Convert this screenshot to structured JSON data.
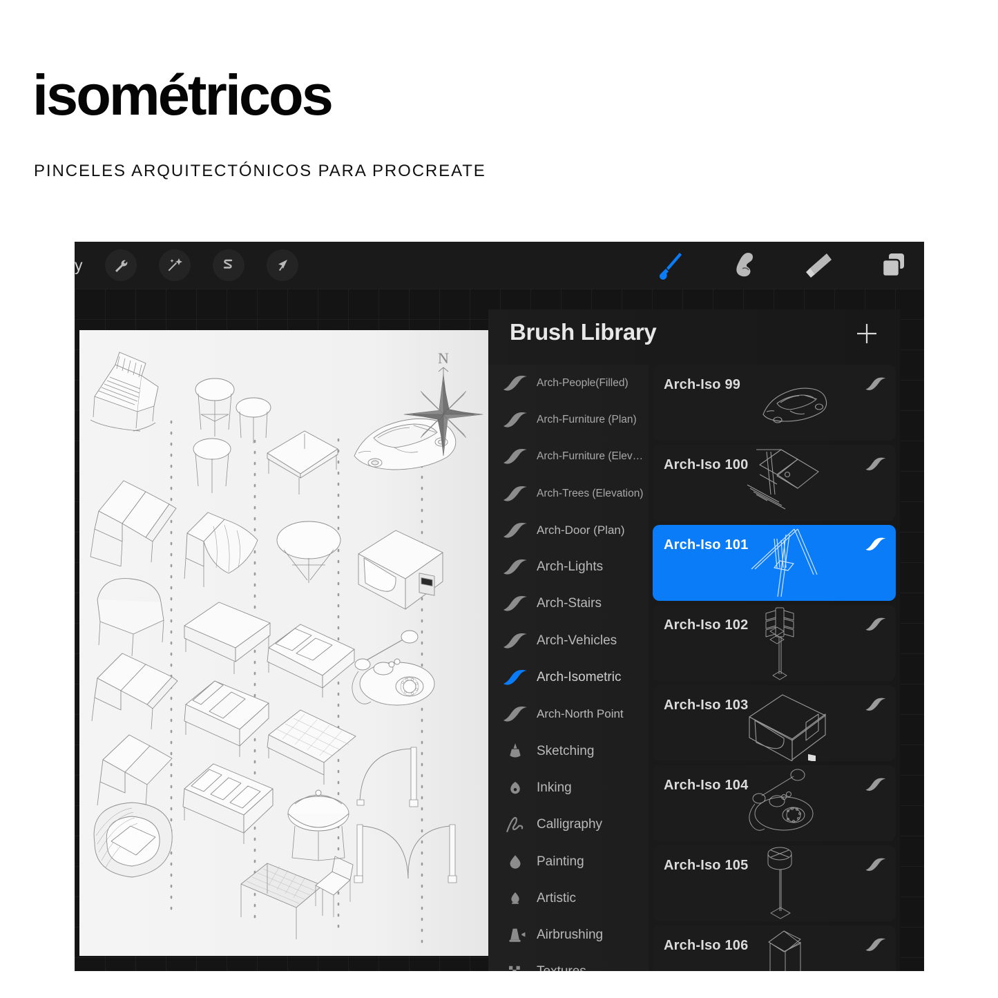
{
  "poster": {
    "title": "isométricos",
    "subtitle": "PINCELES ARQUITECTÓNICOS PARA PROCREATE"
  },
  "colors": {
    "accent_blue": "#0a7cf7",
    "panel_bg": "#1c1c1c",
    "toolbar_bg": "#1a1a1a",
    "canvas_bg": "#f2f2f2",
    "text_primary": "#e8e8e8",
    "text_secondary": "#b9b9b9"
  },
  "app": {
    "toolbar": {
      "gallery_label": "y",
      "left_tools": [
        {
          "name": "wrench-icon",
          "label": "Actions"
        },
        {
          "name": "magic-wand-icon",
          "label": "Adjustments"
        },
        {
          "name": "selection-icon",
          "label": "Selection"
        },
        {
          "name": "transform-arrow-icon",
          "label": "Transform"
        }
      ],
      "right_tools": [
        {
          "name": "paintbrush-icon",
          "label": "Paint",
          "active": true
        },
        {
          "name": "smudge-icon",
          "label": "Smudge",
          "active": false
        },
        {
          "name": "eraser-icon",
          "label": "Erase",
          "active": false
        },
        {
          "name": "layers-icon",
          "label": "Layers",
          "active": false
        }
      ]
    },
    "brush_library": {
      "title": "Brush Library",
      "add_label": "+",
      "sets": [
        {
          "label": "Arch-People(Filled)",
          "size": "small",
          "icon": "brush-stroke-icon",
          "active": false
        },
        {
          "label": "Arch-Furniture (Plan)",
          "size": "small",
          "icon": "brush-stroke-icon",
          "active": false
        },
        {
          "label": "Arch-Furniture (Elev…",
          "size": "small",
          "icon": "brush-stroke-icon",
          "active": false
        },
        {
          "label": "Arch-Trees (Elevation)",
          "size": "small",
          "icon": "brush-stroke-icon",
          "active": false
        },
        {
          "label": "Arch-Door (Plan)",
          "size": "mid",
          "icon": "brush-stroke-icon",
          "active": false
        },
        {
          "label": "Arch-Lights",
          "size": "",
          "icon": "brush-stroke-icon",
          "active": false
        },
        {
          "label": "Arch-Stairs",
          "size": "",
          "icon": "brush-stroke-icon",
          "active": false
        },
        {
          "label": "Arch-Vehicles",
          "size": "",
          "icon": "brush-stroke-icon",
          "active": false
        },
        {
          "label": "Arch-Isometric",
          "size": "",
          "icon": "brush-stroke-icon",
          "active": true
        },
        {
          "label": "Arch-North Point",
          "size": "mid",
          "icon": "brush-stroke-icon",
          "active": false
        },
        {
          "label": "Sketching",
          "size": "",
          "icon": "pencil-icon",
          "active": false
        },
        {
          "label": "Inking",
          "size": "",
          "icon": "nib-icon",
          "active": false
        },
        {
          "label": "Calligraphy",
          "size": "",
          "icon": "calligraphy-icon",
          "active": false
        },
        {
          "label": "Painting",
          "size": "",
          "icon": "droplet-icon",
          "active": false
        },
        {
          "label": "Artistic",
          "size": "",
          "icon": "flame-icon",
          "active": false
        },
        {
          "label": "Airbrushing",
          "size": "",
          "icon": "airbrush-icon",
          "active": false
        },
        {
          "label": "Textures",
          "size": "",
          "icon": "checker-icon",
          "active": false
        }
      ],
      "brushes": [
        {
          "name": "Arch-Iso  99",
          "thumb": "car",
          "selected": false
        },
        {
          "name": "Arch-Iso  100",
          "thumb": "umbrella",
          "selected": false
        },
        {
          "name": "Arch-Iso  101",
          "thumb": "swing",
          "selected": true
        },
        {
          "name": "Arch-Iso  102",
          "thumb": "traffic-light",
          "selected": false
        },
        {
          "name": "Arch-Iso  103",
          "thumb": "microwave",
          "selected": false
        },
        {
          "name": "Arch-Iso  104",
          "thumb": "rotary-phone",
          "selected": false
        },
        {
          "name": "Arch-Iso  105",
          "thumb": "floor-lamp",
          "selected": false
        },
        {
          "name": "Arch-Iso  106",
          "thumb": "pedestal",
          "selected": false
        }
      ]
    },
    "canvas": {
      "compass_label": "N"
    }
  }
}
